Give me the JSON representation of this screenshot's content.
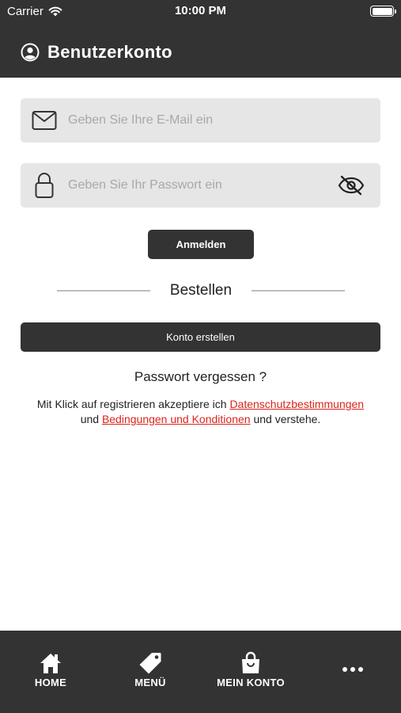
{
  "status_bar": {
    "carrier": "Carrier",
    "time": "10:00 PM"
  },
  "nav": {
    "title": "Benutzerkonto",
    "icon": "user-circle-icon"
  },
  "form": {
    "email_placeholder": "Geben Sie Ihre E-Mail ein",
    "email_value": "",
    "password_placeholder": "Geben Sie Ihr Passwort ein",
    "password_value": "",
    "login_label": "Anmelden"
  },
  "divider": {
    "label": "Bestellen"
  },
  "create_account_label": "Konto erstellen",
  "forgot_password": "Passwort vergessen ?",
  "terms": {
    "text_1": "Mit Klick auf registrieren akzeptiere ich",
    "link_privacy": "Datenschutzbestimmungen",
    "text_2": "und",
    "link_conditions": "Bedingungen und Konditionen",
    "text_3": "und verstehe."
  },
  "tabs": [
    {
      "label": "HOME",
      "icon": "home-icon"
    },
    {
      "label": "MENÜ",
      "icon": "tag-icon"
    },
    {
      "label": "MEIN KONTO",
      "icon": "shopping-bag-icon"
    },
    {
      "label": "",
      "icon": "more-icon"
    }
  ],
  "colors": {
    "header_bg": "#333333",
    "field_bg": "#e6e6e6",
    "link": "#d9251c",
    "button_bg": "#333333"
  }
}
